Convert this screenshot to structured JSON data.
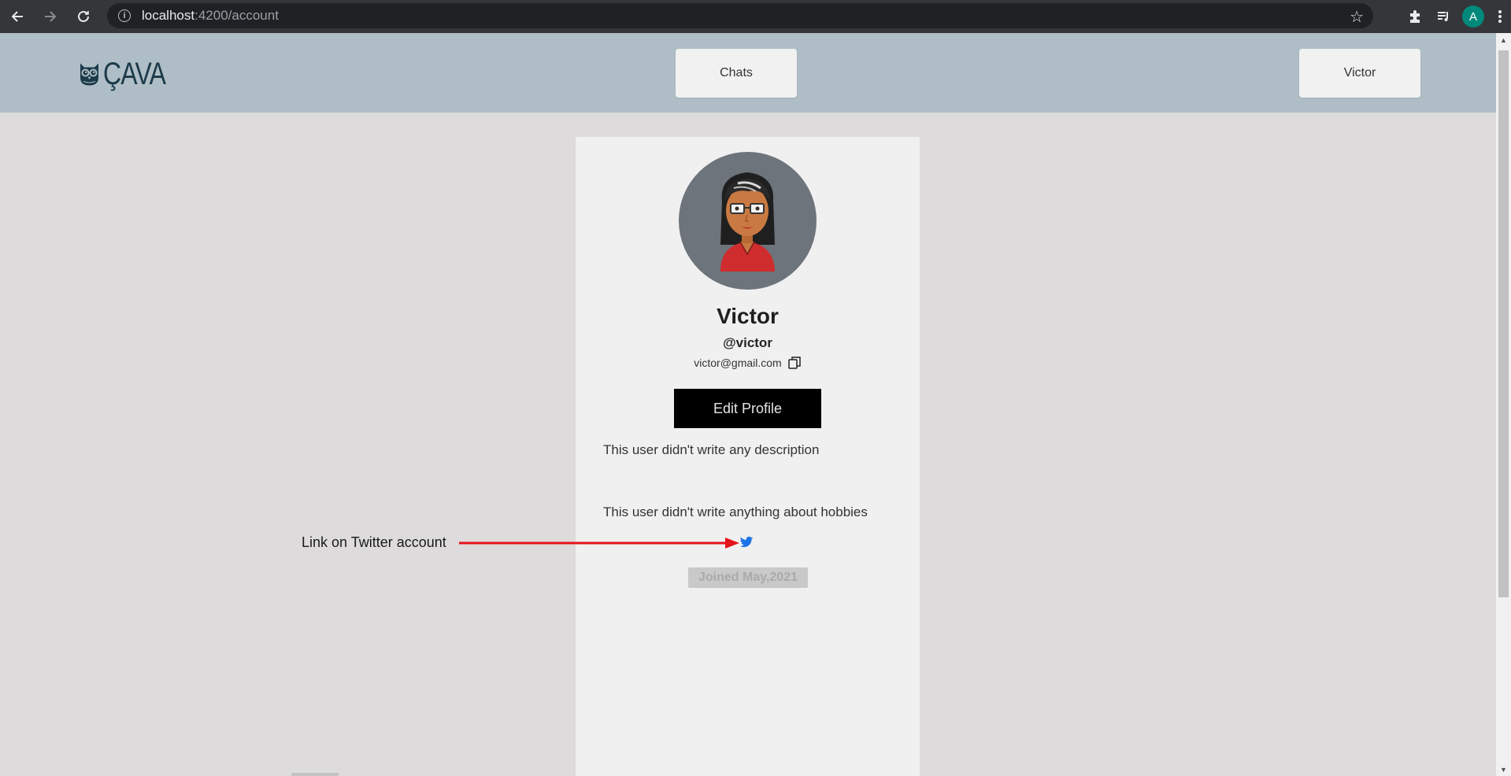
{
  "browser": {
    "url_host": "localhost",
    "url_path": ":4200/account",
    "profile_initial": "A"
  },
  "header": {
    "logo_text": "ÇAVA",
    "chats_label": "Chats",
    "user_label": "Victor"
  },
  "profile": {
    "display_name": "Victor",
    "username": "@victor",
    "email": "victor@gmail.com",
    "edit_label": "Edit Profile",
    "description": "This user didn't write any description",
    "hobbies": "This user didn't write anything about hobbies",
    "joined": "Joined May,2021"
  },
  "annotation": {
    "label": "Link on Twitter account",
    "arrow_color": "#e4141b"
  },
  "colors": {
    "header_bg": "#afbec6",
    "page_bg": "#dddbdc",
    "card_bg": "#f0f0f0",
    "twitter_blue": "#1d74e8"
  },
  "icons": {
    "back": "back-arrow-icon",
    "forward": "forward-arrow-icon",
    "reload": "reload-icon",
    "site_info": "info-icon",
    "bookmark": "star-icon",
    "extensions": "puzzle-icon",
    "media": "queue-music-icon",
    "menu": "kebab-menu-icon",
    "copy": "copy-icon",
    "twitter": "twitter-icon"
  }
}
